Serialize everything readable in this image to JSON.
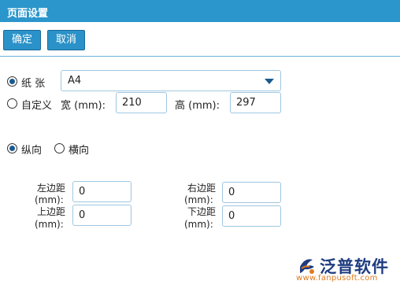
{
  "window": {
    "title": "页面设置"
  },
  "toolbar": {
    "ok_label": "确定",
    "cancel_label": "取消"
  },
  "paper": {
    "radio_label": "纸 张",
    "selected": "A4",
    "custom_label": "自定义",
    "width_label": "宽 (mm):",
    "width_value": "210",
    "height_label": "高 (mm):",
    "height_value": "297"
  },
  "orientation": {
    "portrait_label": "纵向",
    "landscape_label": "横向",
    "selected": "portrait"
  },
  "margins": {
    "left_label_1": "左边距",
    "left_label_2": "(mm):",
    "left_value": "0",
    "right_label_1": "右边距",
    "right_label_2": "(mm):",
    "right_value": "0",
    "top_label_1": "上边距",
    "top_label_2": "(mm):",
    "top_value": "0",
    "bottom_label_1": "下边距",
    "bottom_label_2": "(mm):",
    "bottom_value": "0"
  },
  "watermark": {
    "brand": "泛普软件",
    "url": "www.fanpusoft.com",
    "icon": "fanpu-logo-icon"
  },
  "colors": {
    "titlebar": "#2b96cc",
    "button": "#2a92c8",
    "border": "#9fc6e0",
    "accent": "#1a5a90"
  }
}
